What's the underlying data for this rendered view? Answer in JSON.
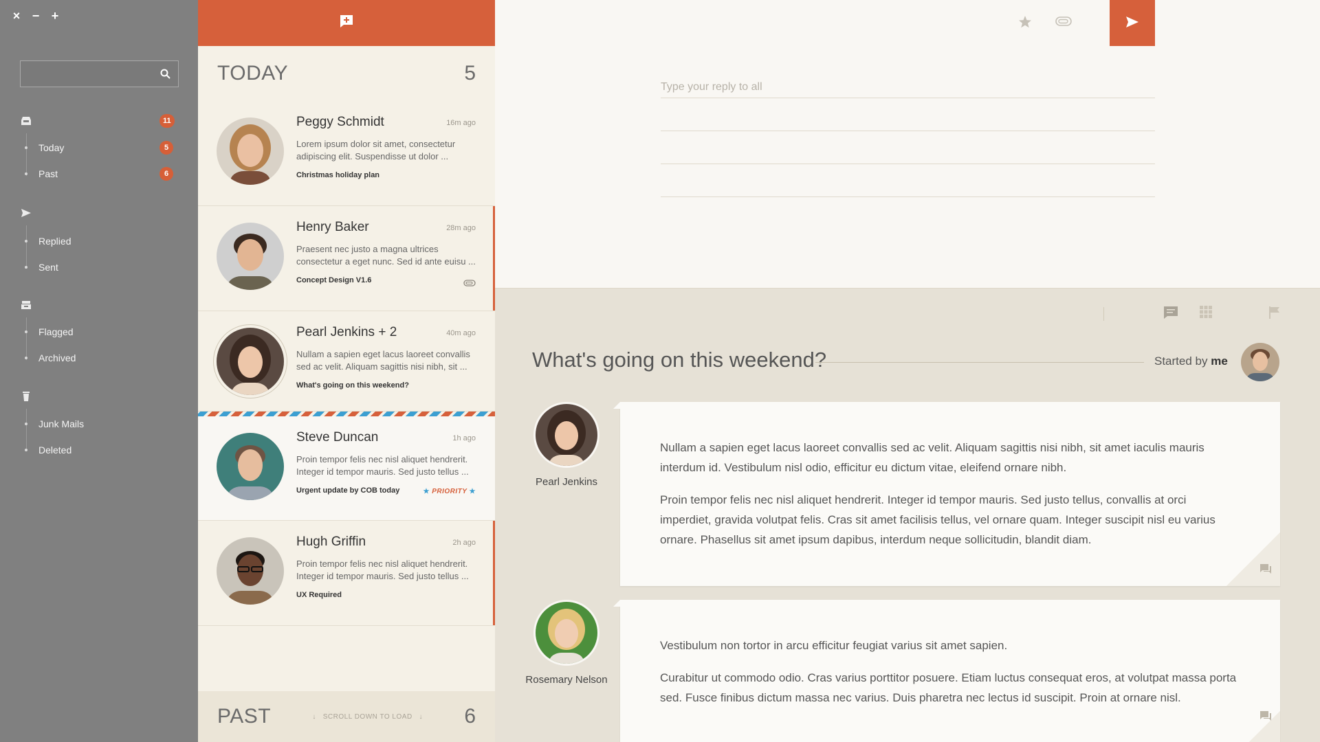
{
  "window": {
    "close": "×",
    "minimize": "−",
    "maximize": "+"
  },
  "sidebar": {
    "search": {
      "value": "",
      "placeholder": ""
    },
    "groups": [
      {
        "icon": "inbox-icon",
        "badge": "11",
        "items": [
          {
            "label": "Today",
            "badge": "5"
          },
          {
            "label": "Past",
            "badge": "6"
          }
        ]
      },
      {
        "icon": "send-icon",
        "items": [
          {
            "label": "Replied"
          },
          {
            "label": "Sent"
          }
        ]
      },
      {
        "icon": "archive-icon",
        "items": [
          {
            "label": "Flagged"
          },
          {
            "label": "Archived"
          }
        ]
      },
      {
        "icon": "trash-icon",
        "items": [
          {
            "label": "Junk Mails"
          },
          {
            "label": "Deleted"
          }
        ]
      }
    ]
  },
  "list": {
    "today": {
      "title": "TODAY",
      "count": "5"
    },
    "past": {
      "title": "PAST",
      "count": "6",
      "hint": "SCROLL DOWN TO LOAD"
    },
    "messages": [
      {
        "name": "Peggy Schmidt",
        "time": "16m ago",
        "preview": "Lorem ipsum dolor sit amet, consectetur adipiscing elit. Suspendisse ut dolor ...",
        "subject": "Christmas holiday plan"
      },
      {
        "name": "Henry Baker",
        "time": "28m ago",
        "preview": "Praesent nec justo a magna ultrices consectetur a eget nunc. Sed id ante euisu ...",
        "subject": "Concept Design V1.6"
      },
      {
        "name": "Pearl Jenkins + 2",
        "time": "40m ago",
        "preview": "Nullam a sapien eget lacus laoreet convallis sed ac velit. Aliquam sagittis nisi nibh, sit ...",
        "subject": "What's going on this weekend?"
      },
      {
        "name": "Steve Duncan",
        "time": "1h ago",
        "preview": "Proin tempor felis nec nisl aliquet hendrerit. Integer id tempor mauris. Sed justo tellus ...",
        "subject": "Urgent update by COB today",
        "priority": "PRIORITY"
      },
      {
        "name": "Hugh Griffin",
        "time": "2h ago",
        "preview": "Proin tempor felis nec nisl aliquet hendrerit. Integer id tempor mauris. Sed justo tellus ...",
        "subject": "UX Required"
      }
    ]
  },
  "reply": {
    "placeholder": "Type your reply to all"
  },
  "thread": {
    "title": "What's going on this weekend?",
    "started_prefix": "Started by",
    "started_by": "me",
    "posts": [
      {
        "author": "Pearl Jenkins",
        "paragraphs": [
          "Nullam a sapien eget lacus laoreet convallis sed ac velit. Aliquam sagittis nisi nibh, sit amet iaculis mauris interdum id. Vestibulum nisl odio, efficitur eu dictum vitae, eleifend ornare nibh.",
          "Proin tempor felis nec nisl aliquet hendrerit. Integer id tempor mauris. Sed justo tellus, convallis at orci imperdiet, gravida volutpat felis. Cras sit amet facilisis tellus, vel ornare quam. Integer suscipit nisl eu varius ornare. Phasellus sit amet ipsum dapibus, interdum neque sollicitudin, blandit diam."
        ]
      },
      {
        "author": "Rosemary Nelson",
        "paragraphs": [
          "Vestibulum non tortor in arcu efficitur feugiat varius sit amet sapien.",
          "Curabitur ut commodo odio. Cras varius porttitor posuere. Etiam luctus consequat eros, at volutpat massa porta sed. Fusce finibus dictum massa nec varius. Duis pharetra nec lectus id suscipit. Proin at ornare nisl."
        ]
      }
    ]
  },
  "colors": {
    "accent": "#d6603b",
    "sidebar": "#808080",
    "list_bg": "#f5f1e7",
    "thread_bg": "#e6e1d6",
    "priority_star": "#3c9fd1"
  }
}
